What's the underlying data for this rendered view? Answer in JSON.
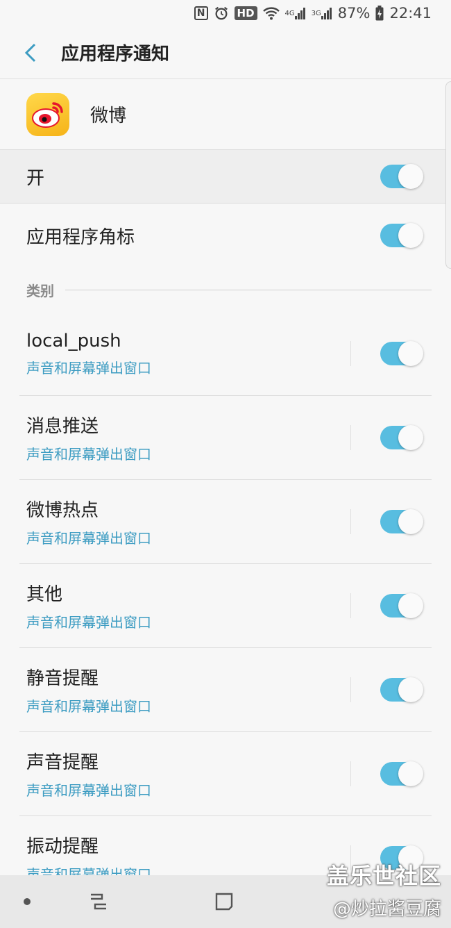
{
  "statusbar": {
    "nfc": "N",
    "hd": "HD",
    "net1": "4G",
    "net2": "3G",
    "battery": "87%",
    "time": "22:41"
  },
  "appbar": {
    "title": "应用程序通知"
  },
  "app": {
    "name": "微博"
  },
  "master": {
    "label": "开",
    "on": true
  },
  "badge": {
    "label": "应用程序角标",
    "on": true
  },
  "category": {
    "label": "类别"
  },
  "channels": [
    {
      "title": "local_push",
      "sub": "声音和屏幕弹出窗口",
      "on": true
    },
    {
      "title": "消息推送",
      "sub": "声音和屏幕弹出窗口",
      "on": true
    },
    {
      "title": "微博热点",
      "sub": "声音和屏幕弹出窗口",
      "on": true
    },
    {
      "title": "其他",
      "sub": "声音和屏幕弹出窗口",
      "on": true
    },
    {
      "title": "静音提醒",
      "sub": "声音和屏幕弹出窗口",
      "on": true
    },
    {
      "title": "声音提醒",
      "sub": "声音和屏幕弹出窗口",
      "on": true
    },
    {
      "title": "振动提醒",
      "sub": "声音和屏幕弹出窗口",
      "on": true
    }
  ],
  "watermark": {
    "title": "盖乐世社区",
    "sub": "@炒拉酱豆腐"
  },
  "colors": {
    "accent": "#58bde0",
    "subtitle": "#3d9cc2",
    "logo": "#f6b318"
  }
}
